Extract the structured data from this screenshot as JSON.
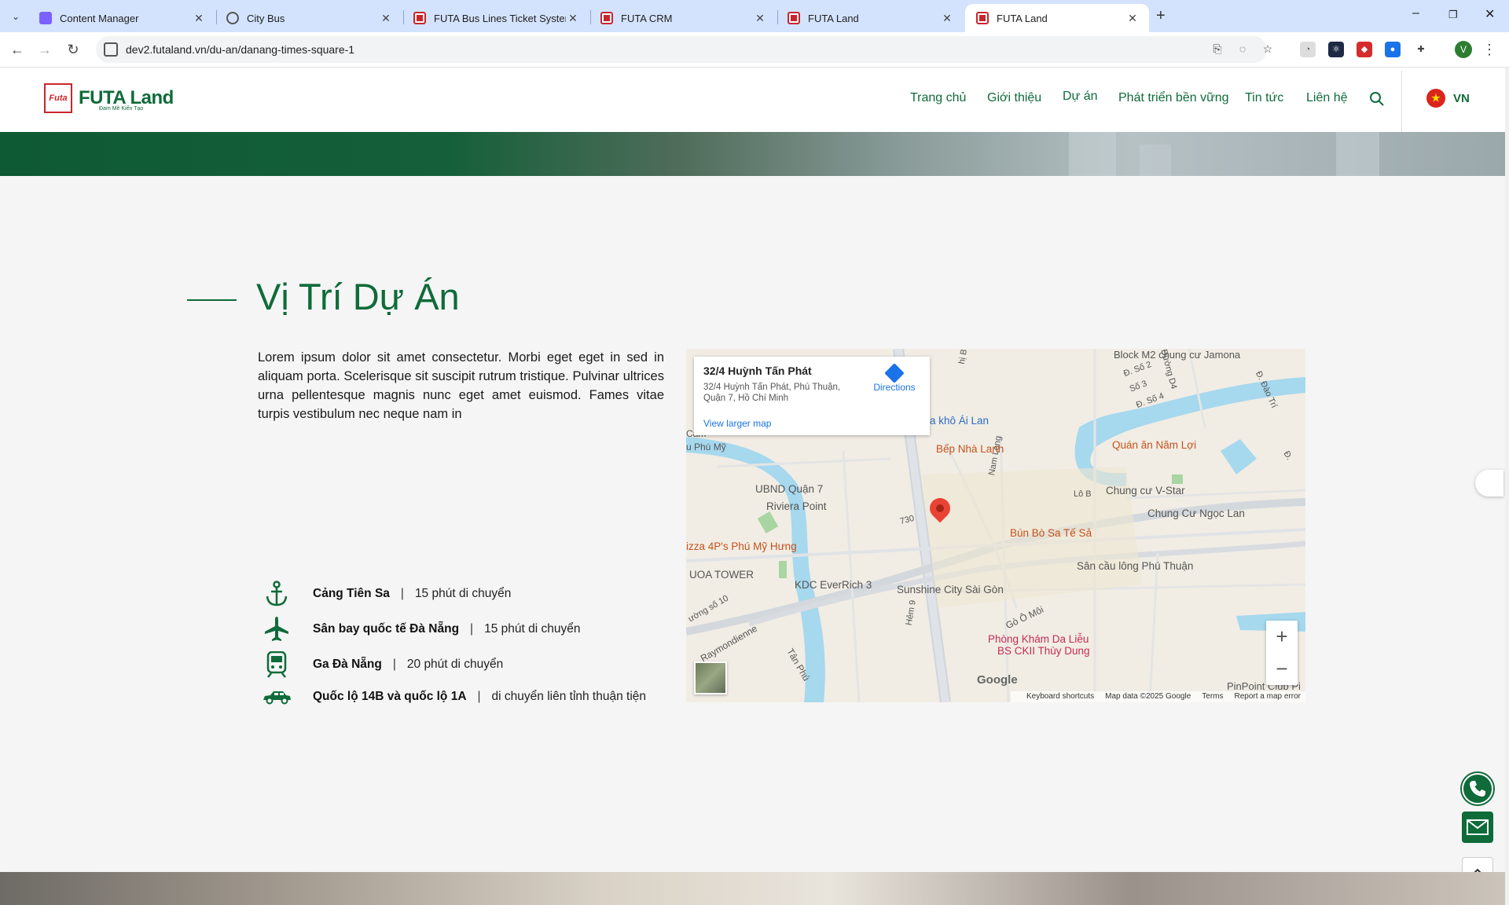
{
  "browser": {
    "tabs": [
      {
        "title": "Content Manager",
        "icon": "content-manager-icon"
      },
      {
        "title": "City Bus",
        "icon": "globe-icon"
      },
      {
        "title": "FUTA Bus Lines Ticket System",
        "icon": "futa-icon"
      },
      {
        "title": "FUTA CRM",
        "icon": "futa-icon"
      },
      {
        "title": "FUTA Land",
        "icon": "futa-icon"
      },
      {
        "title": "FUTA Land",
        "icon": "futa-icon",
        "active": true
      }
    ],
    "url": "dev2.futaland.vn/du-an/danang-times-square-1",
    "profile_initial": "V"
  },
  "header": {
    "logo_badge": "Futa",
    "logo_text": "FUTA Land",
    "logo_tagline": "Đam Mê Kiến Tạo",
    "nav": [
      "Trang chủ",
      "Giới thiệu",
      "Dự án",
      "Phát triển bền vững",
      "Tin tức",
      "Liên hệ"
    ],
    "lang": "VN"
  },
  "section": {
    "title": "Vị Trí Dự Án",
    "description": "Lorem ipsum dolor sit amet consectetur. Morbi eget eget in sed in aliquam porta. Scelerisque sit suscipit rutrum tristique. Pulvinar ultrices urna pellentesque magnis nunc eget amet euismod. Fames vitae turpis vestibulum nec neque nam in",
    "locations": [
      {
        "icon": "anchor-icon",
        "name": "Cảng Tiên Sa",
        "info": "15 phút di chuyển"
      },
      {
        "icon": "airplane-icon",
        "name": "Sân bay quốc tế Đà Nẵng",
        "info": "15 phút di chuyển"
      },
      {
        "icon": "train-icon",
        "name": "Ga Đà Nẵng",
        "info": "20 phút di chuyển"
      },
      {
        "icon": "car-icon",
        "name": "Quốc lộ 14B và quốc lộ 1A",
        "info": "di chuyển liên tỉnh thuận tiện"
      }
    ]
  },
  "map": {
    "place_name": "32/4 Huỳnh Tấn Phát",
    "place_address": "32/4 Huỳnh Tấn Phát, Phú Thuận, Quận 7, Hồ Chí Minh",
    "directions": "Directions",
    "view_larger": "View larger map",
    "google": "Google",
    "footer": [
      "Keyboard shortcuts",
      "Map data ©2025 Google",
      "Terms",
      "Report a map error"
    ],
    "labels": {
      "block_m2": "Block M2 chung cư Jamona",
      "kho_ai_lan": "a khô Ái Lan",
      "bep_nha_lanh": "Bếp Nhà Lanh",
      "quan_an_nam_loi": "Quán ăn Năm Lợi",
      "ubnd": "UBND Quận 7",
      "riviera": "Riviera Point",
      "chung_cu_vstar": "Chung cư V-Star",
      "chung_cu_ngoc_lan": "Chung Cư Ngọc Lan",
      "bun_bo": "Bún Bò Sa Tế Sả",
      "pizza": "izza 4P's Phú Mỹ Hưng",
      "san_cau_long": "Sân cầu lông Phú Thuận",
      "uoa": "UOA TOWER",
      "kdc": "KDC EverRich 3",
      "sunshine": "Sunshine City Sài Gòn",
      "phong_kham": "Phòng Khám Da Liễu",
      "phong_kham_2": "BS CKII Thùy Dung",
      "pinpoint": "PinPoint Club Pi",
      "phu_my": "u Phú Mỹ",
      "cam": "Cam",
      "duong_730": "730",
      "go_o_moi": "Gò Ô Môi",
      "raymondienne": "Raymondienne",
      "tan_phu": "Tân Phú",
      "hem9": "Hẻm 9",
      "nam_long": "Nam Long",
      "lo_b": "Lô B",
      "dao_tri": "Đ. Đào Trí",
      "d_so2": "Đ. Số 2",
      "so3": "Số 3",
      "d_so4": "Đ. Số 4",
      "duong_d4": "Đường D4",
      "duong_so10": "ường số 10",
      "hi_b": "hị B",
      "d_right": "Đ."
    }
  }
}
